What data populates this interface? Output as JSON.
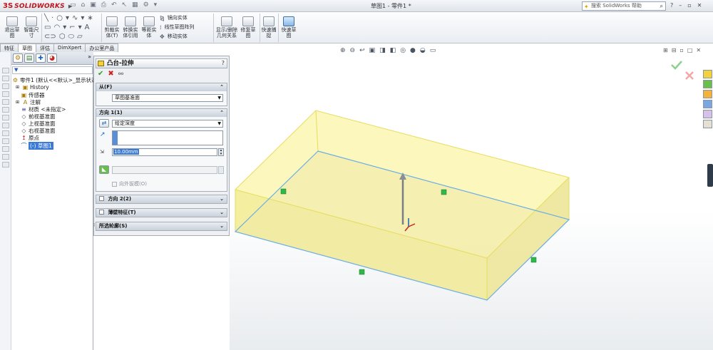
{
  "app": {
    "logo_mark": "3S",
    "logo_text": "SOLIDWORKS",
    "title": "草图1 - 零件1 *",
    "search_placeholder": "搜索 SolidWorks 帮助"
  },
  "ribbon": {
    "exit_sketch": "退出草图",
    "smart_dimension": "智能尺寸",
    "trim": "剪裁实体(T)",
    "convert": "转换实体引用",
    "offset": "等距实体",
    "mirror": "镜向实体",
    "linear_pattern": "线性草图阵列",
    "move": "移动实体",
    "display_delete_relations": "显示/删除几何关系",
    "repair_sketch": "修复草图",
    "quick_snaps": "快速捕捉",
    "rapid_sketch": "快速草图"
  },
  "tabs": [
    "特征",
    "草图",
    "评估",
    "DimXpert",
    "办公室产品"
  ],
  "tree": {
    "part": "零件1 (默认<<默认>_显示状态",
    "items": [
      "History",
      "传感器",
      "注解",
      "材质 <未指定>",
      "前视基准面",
      "上视基准面",
      "右视基准面",
      "原点",
      "(-) 草图1"
    ]
  },
  "property_manager": {
    "title": "凸台-拉伸",
    "help": "?",
    "from": {
      "header": "从(F)",
      "value": "草图基准面"
    },
    "direction1": {
      "header": "方向 1(1)",
      "end_condition": "给定深度",
      "depth": "10.00mm",
      "draft_outward": "向外拔模(O)"
    },
    "direction2": "方向 2(2)",
    "thin_feature": "薄壁特征(T)",
    "selected_contours": "所选轮廓(S)"
  },
  "colors": {
    "accent": "#3b7bd6",
    "solid_top": "#fbf6b2",
    "solid_side": "#f6f0a4",
    "solid_edge": "#e6dc5a",
    "sketch_line": "#6aaee6",
    "ok_green": "#2e9e2e",
    "cancel_red": "#d02020"
  }
}
